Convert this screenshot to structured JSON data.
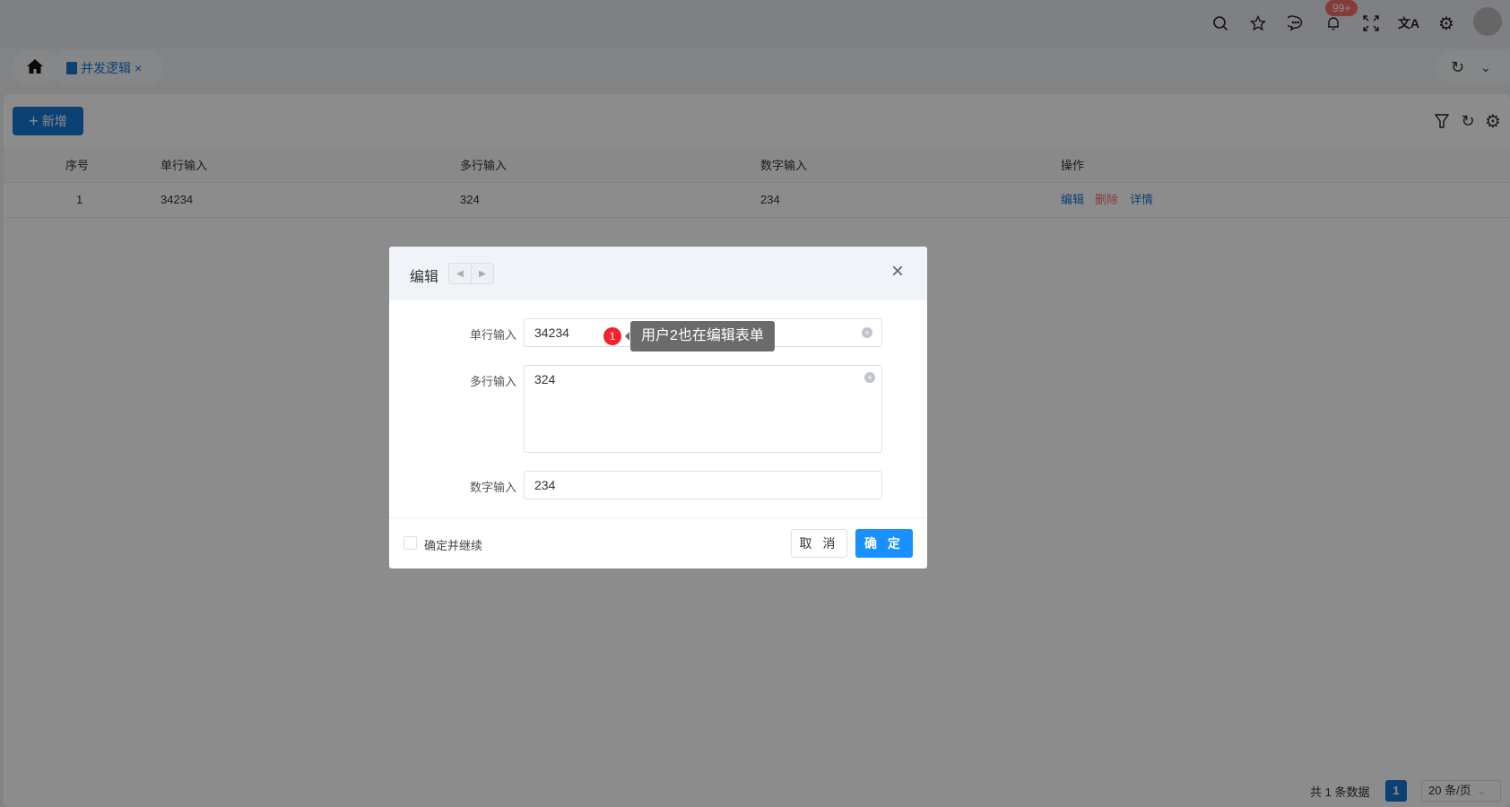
{
  "header": {
    "badge": "99+",
    "icons": [
      "search-icon",
      "star-icon",
      "message-icon",
      "bell-icon",
      "fullscreen-icon",
      "translate-icon",
      "gear-icon"
    ]
  },
  "tabs": [
    {
      "label": "并发逻辑",
      "close": "×"
    }
  ],
  "toolbar": {
    "add_label": "新增",
    "add_icon": "+"
  },
  "table": {
    "headers": [
      "序号",
      "单行输入",
      "多行输入",
      "数字输入",
      "操作"
    ],
    "rows": [
      {
        "index": "1",
        "single": "34234",
        "multi": "324",
        "number": "234",
        "actions": [
          "编辑",
          "删除",
          "详情"
        ]
      }
    ]
  },
  "pagination": {
    "total": "共 1 条数据",
    "page": "1",
    "size": "20 条/页"
  },
  "modal": {
    "title": "编辑",
    "fields": [
      {
        "label": "单行输入",
        "value": "34234"
      },
      {
        "label": "多行输入",
        "value": "324"
      },
      {
        "label": "数字输入",
        "value": "234"
      }
    ],
    "tooltip": {
      "badge": "1",
      "text": "用户2也在编辑表单"
    },
    "continue_label": "确定并继续",
    "cancel": "取 消",
    "ok": "确 定"
  },
  "colors": {
    "primary": "#1677d2",
    "danger": "#f56c6c",
    "modal_ok": "#1890ff"
  }
}
